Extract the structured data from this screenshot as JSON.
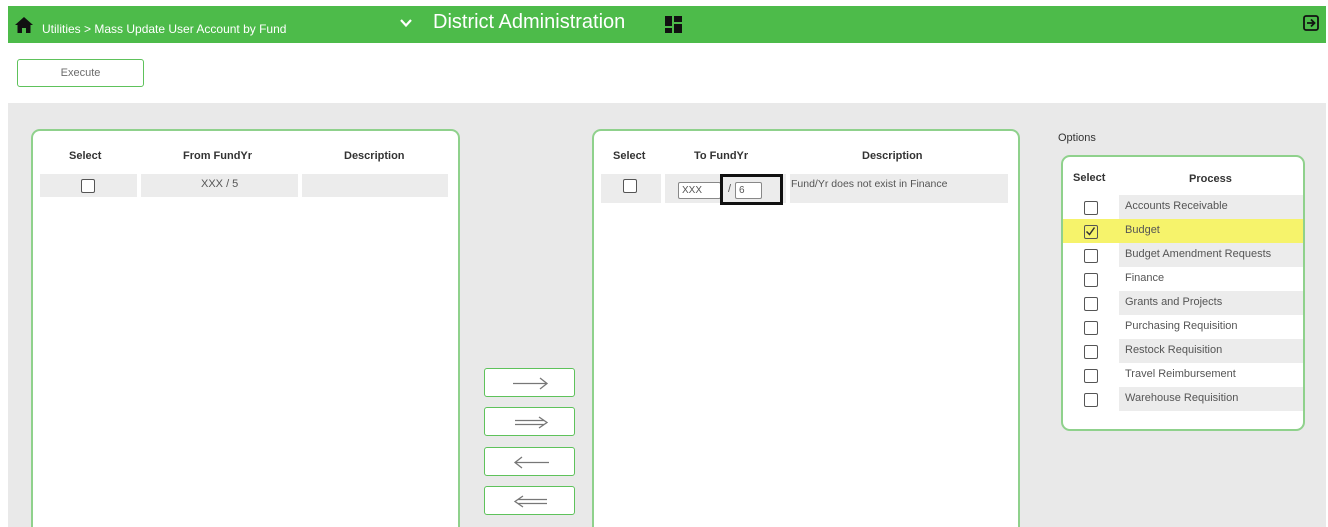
{
  "header": {
    "breadcrumb": "Utilities > Mass Update User Account by Fund",
    "title": "District Administration",
    "icons": {
      "home": "home-icon",
      "chevron": "chevron-down-icon",
      "grid": "grid-icon",
      "exit": "exit-icon"
    }
  },
  "toolbar": {
    "execute_label": "Execute"
  },
  "from_table": {
    "columns": [
      "Select",
      "From FundYr",
      "Description"
    ],
    "rows": [
      {
        "fund_yr": "XXX / 5",
        "description": "",
        "selected": false
      }
    ]
  },
  "to_table": {
    "columns": [
      "Select",
      "To FundYr",
      "Description"
    ],
    "rows": [
      {
        "fund": "XXX",
        "separator": "/",
        "year": "6",
        "description": "Fund/Yr does not exist in Finance",
        "selected": false
      }
    ]
  },
  "transfer_buttons": [
    {
      "name": "move-right-button",
      "icon": "arrow-right-icon"
    },
    {
      "name": "move-all-right-button",
      "icon": "double-arrow-right-icon"
    },
    {
      "name": "move-left-button",
      "icon": "arrow-left-icon"
    },
    {
      "name": "move-all-left-button",
      "icon": "double-arrow-left-icon"
    }
  ],
  "options": {
    "label": "Options",
    "columns": [
      "Select",
      "Process"
    ],
    "items": [
      {
        "label": "Accounts Receivable",
        "checked": false
      },
      {
        "label": "Budget",
        "checked": true
      },
      {
        "label": "Budget Amendment Requests",
        "checked": false
      },
      {
        "label": "Finance",
        "checked": false
      },
      {
        "label": "Grants and Projects",
        "checked": false
      },
      {
        "label": "Purchasing Requisition",
        "checked": false
      },
      {
        "label": "Restock Requisition",
        "checked": false
      },
      {
        "label": "Travel Reimbursement",
        "checked": false
      },
      {
        "label": "Warehouse Requisition",
        "checked": false
      }
    ]
  },
  "colors": {
    "header_green": "#4dbb4a",
    "panel_border": "#8fd18c",
    "highlight": "#f6f36b"
  }
}
